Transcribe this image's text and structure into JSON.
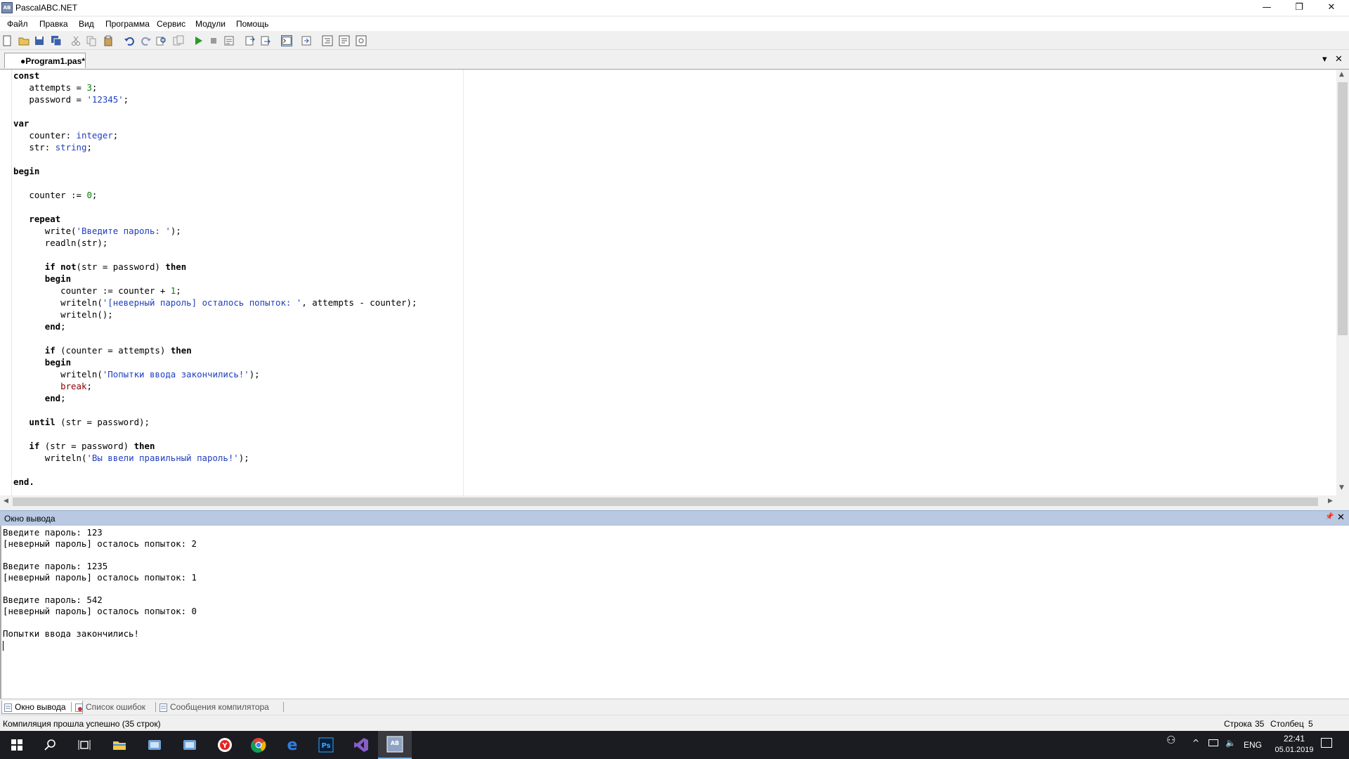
{
  "window": {
    "title": "PascalABC.NET",
    "icon_text": "AB",
    "controls": {
      "minimize": "—",
      "restore": "❐",
      "close": "✕"
    }
  },
  "menu": [
    {
      "name": "menu-file",
      "label": "Файл"
    },
    {
      "name": "menu-edit",
      "label": "Правка"
    },
    {
      "name": "menu-view",
      "label": "Вид"
    },
    {
      "name": "menu-program",
      "label": "Программа"
    },
    {
      "name": "menu-service",
      "label": "Сервис"
    },
    {
      "name": "menu-modules",
      "label": "Модули"
    },
    {
      "name": "menu-help",
      "label": "Помощь"
    }
  ],
  "toolbar_icons": [
    "new-file-icon",
    "open-folder-icon",
    "save-icon",
    "save-all-icon",
    "cut-icon",
    "copy-icon",
    "paste-icon",
    "undo-icon",
    "redo-icon",
    "find-icon",
    "replace-icon",
    "run-icon",
    "stop-icon",
    "compile-icon",
    "step-into-icon",
    "step-over-icon",
    "console-output-icon",
    "goto-cursor-icon",
    "format-code-icon",
    "debug-panel-icon",
    "watch-panel-icon"
  ],
  "editor": {
    "tab_label": "●Program1.pas*",
    "tab_menu_glyph": "▾",
    "tab_close_glyph": "✕",
    "code_lines": [
      [
        {
          "t": "const",
          "c": "kw"
        }
      ],
      [
        {
          "t": "   attempts = "
        },
        {
          "t": "3",
          "c": "num"
        },
        {
          "t": ";"
        }
      ],
      [
        {
          "t": "   password = "
        },
        {
          "t": "'12345'",
          "c": "str"
        },
        {
          "t": ";"
        }
      ],
      [],
      [
        {
          "t": "var",
          "c": "kw"
        }
      ],
      [
        {
          "t": "   counter: "
        },
        {
          "t": "integer",
          "c": "typ"
        },
        {
          "t": ";"
        }
      ],
      [
        {
          "t": "   str: "
        },
        {
          "t": "string",
          "c": "typ"
        },
        {
          "t": ";"
        }
      ],
      [],
      [
        {
          "t": "begin",
          "c": "kw"
        }
      ],
      [],
      [
        {
          "t": "   counter := "
        },
        {
          "t": "0",
          "c": "num"
        },
        {
          "t": ";"
        }
      ],
      [],
      [
        {
          "t": "   "
        },
        {
          "t": "repeat",
          "c": "kw"
        }
      ],
      [
        {
          "t": "      write("
        },
        {
          "t": "'Введите пароль: '",
          "c": "str"
        },
        {
          "t": ");"
        }
      ],
      [
        {
          "t": "      readln(str);"
        }
      ],
      [],
      [
        {
          "t": "      "
        },
        {
          "t": "if not",
          "c": "kw"
        },
        {
          "t": "(str = password) "
        },
        {
          "t": "then",
          "c": "kw"
        }
      ],
      [
        {
          "t": "      "
        },
        {
          "t": "begin",
          "c": "kw"
        }
      ],
      [
        {
          "t": "         counter := counter + "
        },
        {
          "t": "1",
          "c": "num"
        },
        {
          "t": ";"
        }
      ],
      [
        {
          "t": "         writeln("
        },
        {
          "t": "'[неверный пароль] осталось попыток: '",
          "c": "str"
        },
        {
          "t": ", attempts - counter);"
        }
      ],
      [
        {
          "t": "         writeln();"
        }
      ],
      [
        {
          "t": "      "
        },
        {
          "t": "end",
          "c": "kw"
        },
        {
          "t": ";"
        }
      ],
      [],
      [
        {
          "t": "      "
        },
        {
          "t": "if",
          "c": "kw"
        },
        {
          "t": " (counter = attempts) "
        },
        {
          "t": "then",
          "c": "kw"
        }
      ],
      [
        {
          "t": "      "
        },
        {
          "t": "begin",
          "c": "kw"
        }
      ],
      [
        {
          "t": "         writeln("
        },
        {
          "t": "'Попытки ввода закончились!'",
          "c": "str"
        },
        {
          "t": ");"
        }
      ],
      [
        {
          "t": "         "
        },
        {
          "t": "break",
          "c": "brk"
        },
        {
          "t": ";"
        }
      ],
      [
        {
          "t": "      "
        },
        {
          "t": "end",
          "c": "kw"
        },
        {
          "t": ";"
        }
      ],
      [],
      [
        {
          "t": "   "
        },
        {
          "t": "until",
          "c": "kw"
        },
        {
          "t": " (str = password);"
        }
      ],
      [],
      [
        {
          "t": "   "
        },
        {
          "t": "if",
          "c": "kw"
        },
        {
          "t": " (str = password) "
        },
        {
          "t": "then",
          "c": "kw"
        }
      ],
      [
        {
          "t": "      writeln("
        },
        {
          "t": "'Вы ввели правильный пароль!'",
          "c": "str"
        },
        {
          "t": ");"
        }
      ],
      [],
      [
        {
          "t": "end.",
          "c": "kw"
        }
      ]
    ]
  },
  "output_panel": {
    "title": "Окно вывода",
    "pin_glyph": "📌",
    "close_glyph": "✕",
    "lines": [
      "Введите пароль: 123",
      "[неверный пароль] осталось попыток: 2",
      "",
      "Введите пароль: 1235",
      "[неверный пароль] осталось попыток: 1",
      "",
      "Введите пароль: 542",
      "[неверный пароль] осталось попыток: 0",
      "",
      "Попытки ввода закончились!"
    ]
  },
  "bottom_tabs": [
    {
      "name": "tab-output-window",
      "label": "Окно вывода",
      "active": true
    },
    {
      "name": "tab-error-list",
      "label": "Список ошибок",
      "active": false
    },
    {
      "name": "tab-compiler-messages",
      "label": "Сообщения компилятора",
      "active": false
    }
  ],
  "status": {
    "message": "Компиляция прошла успешно (35 строк)",
    "row_label": "Строка",
    "row": "35",
    "col_label": "Столбец",
    "col": "5"
  },
  "taskbar": {
    "apps": [
      "windows-start-icon",
      "search-icon",
      "task-view-icon",
      "file-explorer-icon",
      "app-icon",
      "app-icon",
      "yandex-browser-icon",
      "chrome-icon",
      "edge-icon",
      "photoshop-icon",
      "visual-studio-icon",
      "pascalabc-icon"
    ],
    "photoshop_label": "Ps",
    "edge_label": "e",
    "yandex_label": "Y",
    "lang": "ENG",
    "time": "22:41",
    "date": "05.01.2019"
  },
  "colors": {
    "panel_header": "#b8c9e1",
    "keyword": "#000000",
    "string": "#1f3fbf",
    "number": "#008000",
    "taskbar": "#1b1c21"
  }
}
